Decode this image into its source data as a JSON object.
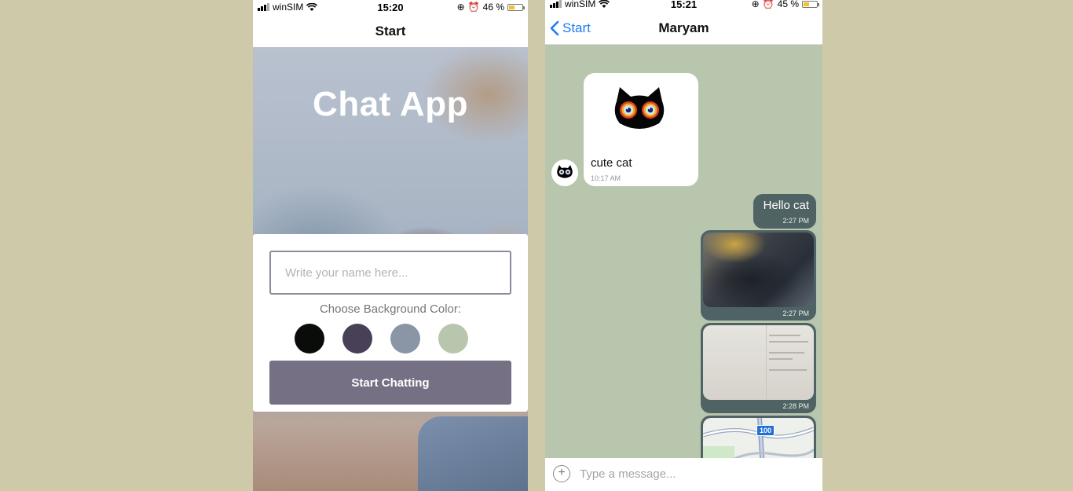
{
  "start_screen": {
    "status": {
      "carrier": "winSIM",
      "time": "15:20",
      "battery": "46 %",
      "battery_level": 0.46
    },
    "nav_title": "Start",
    "app_title": "Chat App",
    "name_input_placeholder": "Write your name here...",
    "color_label": "Choose Background Color:",
    "colors": [
      "#090C08",
      "#474056",
      "#8A95A5",
      "#B9C6AE"
    ],
    "start_button": "Start Chatting"
  },
  "chat_screen": {
    "status": {
      "carrier": "winSIM",
      "time": "15:21",
      "battery": "45 %",
      "battery_level": 0.45
    },
    "back_label": "Start",
    "nav_title": "Maryam",
    "background_color": "#B9C6AE",
    "messages": [
      {
        "from": "other",
        "text": "cute cat",
        "time": "10:17 AM",
        "image": "cat-sticker-icon"
      },
      {
        "from": "me",
        "text": "Hello cat",
        "time": "2:27 PM"
      },
      {
        "from": "me",
        "image": "photo",
        "time": "2:27 PM"
      },
      {
        "from": "me",
        "image": "photo",
        "time": "2:28 PM"
      },
      {
        "from": "me",
        "image": "map",
        "map_badge": "100"
      }
    ],
    "input_placeholder": "Type a message..."
  }
}
